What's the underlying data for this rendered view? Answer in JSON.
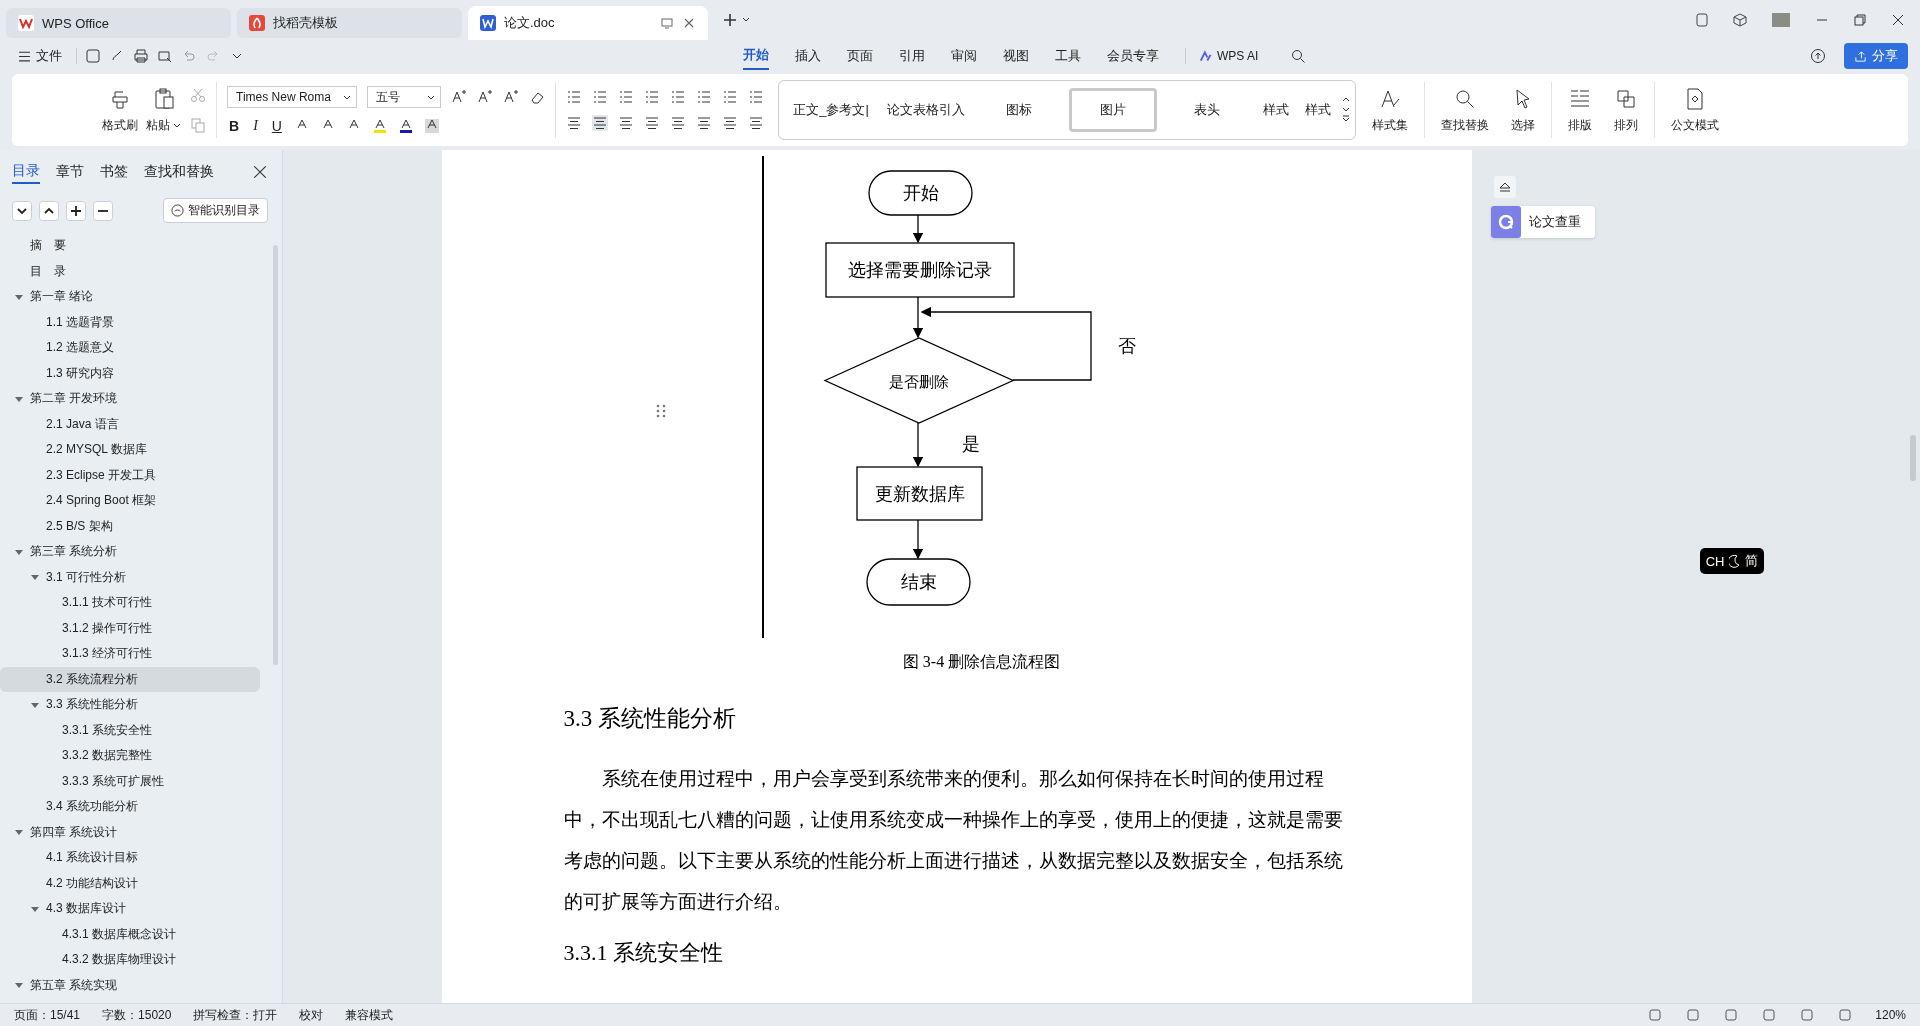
{
  "tabs": [
    {
      "label": "WPS Office",
      "selected": false
    },
    {
      "label": "找稻壳模板",
      "selected": false
    },
    {
      "label": "论文.doc",
      "selected": true
    }
  ],
  "file_menu": "文件",
  "ribbon_tabs": [
    {
      "label": "开始",
      "selected": true
    },
    {
      "label": "插入",
      "selected": false
    },
    {
      "label": "页面",
      "selected": false
    },
    {
      "label": "引用",
      "selected": false
    },
    {
      "label": "审阅",
      "selected": false
    },
    {
      "label": "视图",
      "selected": false
    },
    {
      "label": "工具",
      "selected": false
    },
    {
      "label": "会员专享",
      "selected": false
    }
  ],
  "ai_button": "WPS AI",
  "share_button": "分享",
  "ribbon": {
    "clipboard": [
      "格式刷",
      "粘贴"
    ],
    "font_name": "Times New Roma",
    "font_size": "五号",
    "format_buttons": [
      "B",
      "I",
      "U"
    ],
    "styles": [
      {
        "label": "正文_参考文|",
        "selected": false
      },
      {
        "label": "论文表格引入",
        "selected": false
      },
      {
        "label": "图标",
        "selected": false
      },
      {
        "label": "图片",
        "selected": true
      },
      {
        "label": "表头",
        "selected": false
      },
      {
        "label": "样式",
        "selected": false
      },
      {
        "label": "样式",
        "selected": false
      }
    ],
    "tools": [
      "样式集",
      "查找替换",
      "选择",
      "排版",
      "排列",
      "公文模式"
    ]
  },
  "sidebar": {
    "tabs": [
      {
        "label": "目录",
        "selected": true
      },
      {
        "label": "章节",
        "selected": false
      },
      {
        "label": "书签",
        "selected": false
      },
      {
        "label": "查找和替换",
        "selected": false
      }
    ],
    "smart_toc_button": "智能识别目录",
    "toc": [
      {
        "label": "摘　要",
        "selected": false
      },
      {
        "label": "目　录",
        "selected": false
      },
      {
        "label": "第一章  绪论",
        "selected": false,
        "expanded": true,
        "children": [
          {
            "label": "1.1  选题背景",
            "selected": false
          },
          {
            "label": "1.2  选题意义",
            "selected": false
          },
          {
            "label": "1.3  研究内容",
            "selected": false
          }
        ]
      },
      {
        "label": "第二章  开发环境",
        "selected": false,
        "expanded": true,
        "children": [
          {
            "label": "2.1 Java 语言",
            "selected": false
          },
          {
            "label": "2.2 MYSQL 数据库",
            "selected": false
          },
          {
            "label": "2.3 Eclipse 开发工具",
            "selected": false
          },
          {
            "label": "2.4 Spring Boot 框架",
            "selected": false
          },
          {
            "label": "2.5 B/S 架构",
            "selected": false
          }
        ]
      },
      {
        "label": "第三章  系统分析",
        "selected": false,
        "expanded": true,
        "children": [
          {
            "label": "3.1 可行性分析",
            "selected": false,
            "expanded": true,
            "children": [
              {
                "label": "3.1.1 技术可行性",
                "selected": false
              },
              {
                "label": "3.1.2 操作可行性",
                "selected": false
              },
              {
                "label": "3.1.3 经济可行性",
                "selected": false
              }
            ]
          },
          {
            "label": "3.2 系统流程分析",
            "selected": true
          },
          {
            "label": "3.3 系统性能分析",
            "selected": false,
            "expanded": true,
            "children": [
              {
                "label": "3.3.1 系统安全性",
                "selected": false
              },
              {
                "label": "3.3.2 数据完整性",
                "selected": false
              },
              {
                "label": "3.3.3 系统可扩展性",
                "selected": false
              }
            ]
          },
          {
            "label": "3.4 系统功能分析",
            "selected": false
          }
        ]
      },
      {
        "label": "第四章  系统设计",
        "selected": false,
        "expanded": true,
        "children": [
          {
            "label": "4.1  系统设计目标",
            "selected": false
          },
          {
            "label": "4.2 功能结构设计",
            "selected": false
          },
          {
            "label": "4.3 数据库设计",
            "selected": false,
            "expanded": true,
            "children": [
              {
                "label": "4.3.1  数据库概念设计",
                "selected": false
              },
              {
                "label": "4.3.2  数据库物理设计",
                "selected": false
              }
            ]
          }
        ]
      },
      {
        "label": "第五章  系统实现",
        "selected": false,
        "expanded": true
      }
    ]
  },
  "document": {
    "flowchart": {
      "nodes": [
        {
          "kind": "terminal",
          "text": "开始"
        },
        {
          "kind": "process",
          "text": "选择需要删除记录"
        },
        {
          "kind": "decision",
          "text": "是否删除"
        },
        {
          "kind": "process",
          "text": "更新数据库"
        },
        {
          "kind": "terminal",
          "text": "结束"
        }
      ],
      "no_label": "否",
      "yes_label": "是"
    },
    "caption": "图 3-4  删除信息流程图",
    "heading": "3.3 系统性能分析",
    "paragraph": "系统在使用过程中，用户会享受到系统带来的便利。那么如何保持在长时间的使用过程中，不出现乱七八糟的问题，让使用系统变成一种操作上的享受，使用上的便捷，这就是需要考虑的问题。以下主要从系统的性能分析上面进行描述，从数据完整以及数据安全，包括系统的可扩展等方面进行介绍。",
    "subheading": "3.3.1 系统安全性"
  },
  "right_panel": {
    "check_button": "论文查重"
  },
  "ime": {
    "lang": "CH",
    "mode": "简"
  },
  "status_bar": [
    "页面：15/41",
    "字数：15020",
    "拼写检查：打开",
    "校对",
    "兼容模式"
  ],
  "zoom": "120%"
}
